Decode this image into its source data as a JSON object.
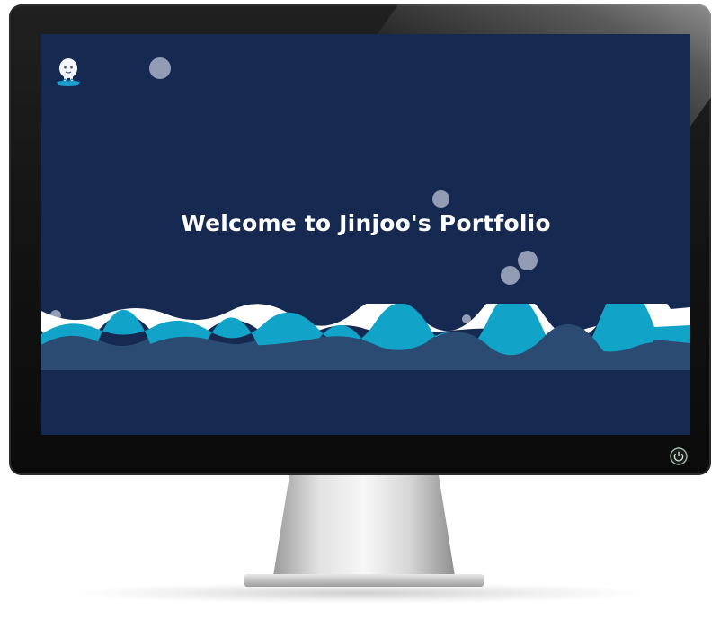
{
  "screen": {
    "headline": "Welcome to Jinjoo's Portfolio",
    "background": "#162951"
  },
  "icons": {
    "logo": "mascot-logo-icon",
    "power": "power-icon"
  },
  "colors": {
    "wave_white": "#ffffff",
    "wave_teal": "#12a3c8",
    "wave_back": "#2b4b72",
    "bubble": "#bec3d7"
  }
}
